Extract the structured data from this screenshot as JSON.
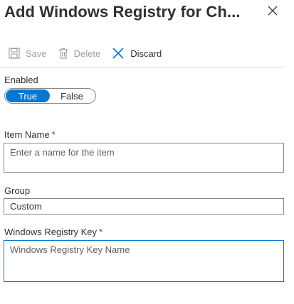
{
  "header": {
    "title": "Add Windows Registry for Ch...",
    "close_icon": "close-icon"
  },
  "toolbar": {
    "save_label": "Save",
    "delete_label": "Delete",
    "discard_label": "Discard",
    "save_icon": "save-icon",
    "delete_icon": "trash-icon",
    "discard_icon": "close-icon",
    "disabled_color": "#a19f9d",
    "accent_color": "#0078d4"
  },
  "form": {
    "enabled": {
      "label": "Enabled",
      "options": [
        "True",
        "False"
      ],
      "selected": "True"
    },
    "item_name": {
      "label": "Item Name",
      "required_marker": "*",
      "value": "",
      "placeholder": "Enter a name for the item"
    },
    "group": {
      "label": "Group",
      "value": "Custom"
    },
    "registry_key": {
      "label": "Windows Registry Key",
      "required_marker": "*",
      "value": "",
      "placeholder": "Windows Registry Key Name"
    }
  }
}
